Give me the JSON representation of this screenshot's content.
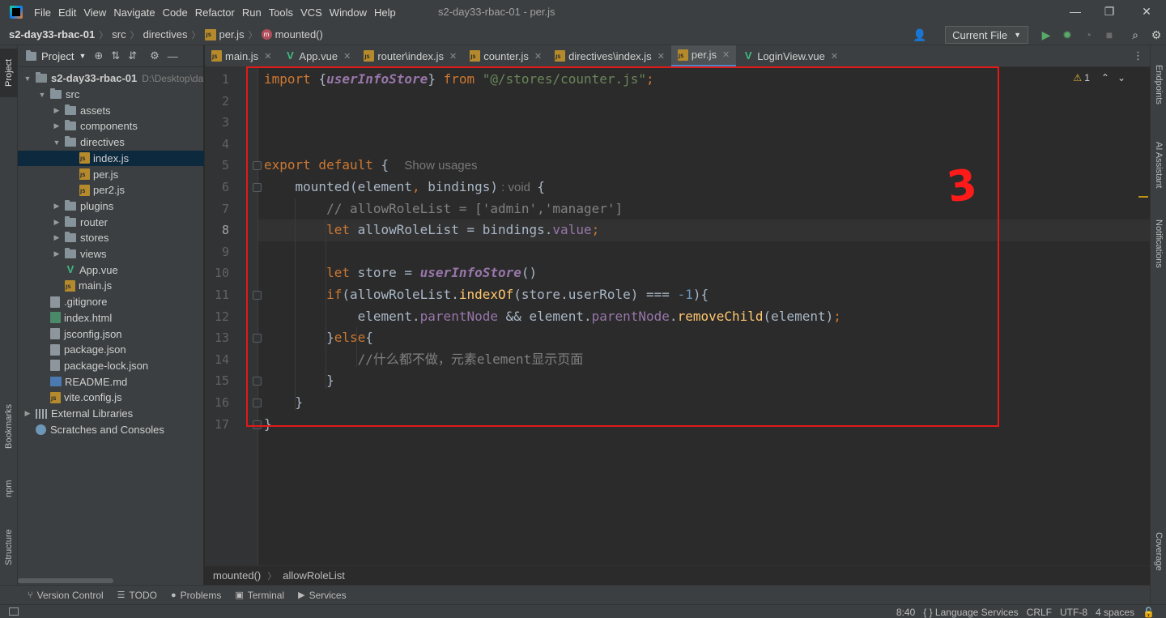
{
  "window": {
    "title": "s2-day33-rbac-01 - per.js",
    "minimize": "—",
    "restore": "❐",
    "close": "✕"
  },
  "menu": [
    "File",
    "Edit",
    "View",
    "Navigate",
    "Code",
    "Refactor",
    "Run",
    "Tools",
    "VCS",
    "Window",
    "Help"
  ],
  "navbar": {
    "project": "s2-day33-rbac-01",
    "crumbs": [
      "src",
      "directives",
      "per.js",
      "mounted()"
    ],
    "run_config": "Current File",
    "run_config_arrow": "▼"
  },
  "left_tabs": {
    "project": "Project",
    "bookmarks": "Bookmarks",
    "npm": "npm",
    "structure": "Structure"
  },
  "right_tabs": {
    "endpoints": "Endpoints",
    "ai_assistant": "AI Assistant",
    "notifications": "Notifications",
    "coverage": "Coverage"
  },
  "project_panel": {
    "title": "Project",
    "title_arrow": "▼",
    "root_path": "D:\\Desktop\\da",
    "tree": [
      {
        "label": "s2-day33-rbac-01",
        "kind": "root",
        "indent": 0,
        "arrow": "open"
      },
      {
        "label": "src",
        "kind": "folder",
        "indent": 1,
        "arrow": "open"
      },
      {
        "label": "assets",
        "kind": "folder",
        "indent": 2,
        "arrow": "closed"
      },
      {
        "label": "components",
        "kind": "folder",
        "indent": 2,
        "arrow": "closed"
      },
      {
        "label": "directives",
        "kind": "folder",
        "indent": 2,
        "arrow": "open"
      },
      {
        "label": "index.js",
        "kind": "js",
        "indent": 3,
        "arrow": "none",
        "selected": true
      },
      {
        "label": "per.js",
        "kind": "js",
        "indent": 3,
        "arrow": "none"
      },
      {
        "label": "per2.js",
        "kind": "js",
        "indent": 3,
        "arrow": "none"
      },
      {
        "label": "plugins",
        "kind": "folder",
        "indent": 2,
        "arrow": "closed"
      },
      {
        "label": "router",
        "kind": "folder",
        "indent": 2,
        "arrow": "closed"
      },
      {
        "label": "stores",
        "kind": "folder",
        "indent": 2,
        "arrow": "closed"
      },
      {
        "label": "views",
        "kind": "folder",
        "indent": 2,
        "arrow": "closed"
      },
      {
        "label": "App.vue",
        "kind": "vue",
        "indent": 2,
        "arrow": "none"
      },
      {
        "label": "main.js",
        "kind": "js",
        "indent": 2,
        "arrow": "none"
      },
      {
        "label": ".gitignore",
        "kind": "file",
        "indent": 1,
        "arrow": "none"
      },
      {
        "label": "index.html",
        "kind": "html",
        "indent": 1,
        "arrow": "none"
      },
      {
        "label": "jsconfig.json",
        "kind": "file",
        "indent": 1,
        "arrow": "none"
      },
      {
        "label": "package.json",
        "kind": "file",
        "indent": 1,
        "arrow": "none"
      },
      {
        "label": "package-lock.json",
        "kind": "file",
        "indent": 1,
        "arrow": "none"
      },
      {
        "label": "README.md",
        "kind": "md",
        "indent": 1,
        "arrow": "none"
      },
      {
        "label": "vite.config.js",
        "kind": "js",
        "indent": 1,
        "arrow": "none"
      },
      {
        "label": "External Libraries",
        "kind": "lib",
        "indent": 0,
        "arrow": "closed"
      },
      {
        "label": "Scratches and Consoles",
        "kind": "scratch",
        "indent": 0,
        "arrow": "none"
      }
    ]
  },
  "tabs": [
    {
      "label": "main.js",
      "kind": "js",
      "active": false
    },
    {
      "label": "App.vue",
      "kind": "vue",
      "active": false
    },
    {
      "label": "router\\index.js",
      "kind": "js",
      "active": false
    },
    {
      "label": "counter.js",
      "kind": "js",
      "active": false
    },
    {
      "label": "directives\\index.js",
      "kind": "js",
      "active": false
    },
    {
      "label": "per.js",
      "kind": "js",
      "active": true
    },
    {
      "label": "LoginView.vue",
      "kind": "vue",
      "active": false
    }
  ],
  "tab_close": "✕",
  "tabs_more": "⋮",
  "editor": {
    "warnings_count": "1",
    "current_line": 8,
    "line_numbers": [
      "1",
      "2",
      "3",
      "4",
      "5",
      "6",
      "7",
      "8",
      "9",
      "10",
      "11",
      "12",
      "13",
      "14",
      "15",
      "16",
      "17"
    ],
    "annotation": "3",
    "lines": [
      [
        [
          "kw",
          "import "
        ],
        [
          "",
          "{"
        ],
        [
          "fn-it",
          "userInfoStore"
        ],
        [
          "",
          "} "
        ],
        [
          "kw",
          "from "
        ],
        [
          "str",
          "\"@/stores/counter.js\""
        ],
        [
          "kw",
          ";"
        ]
      ],
      [],
      [],
      [],
      [
        [
          "kw",
          "export default "
        ],
        [
          "",
          "{  "
        ],
        [
          "hint",
          "Show usages"
        ]
      ],
      [
        [
          "",
          "    "
        ],
        [
          "prop-m",
          "mounted"
        ],
        [
          "",
          "(element"
        ],
        [
          "kw",
          ", "
        ],
        [
          "",
          "bindings)"
        ],
        [
          "hint",
          " : void  "
        ],
        [
          "",
          "{"
        ]
      ],
      [
        [
          "",
          "        "
        ],
        [
          "cmt",
          "// allowRoleList = ['admin','manager']"
        ]
      ],
      [
        [
          "",
          "        "
        ],
        [
          "kw",
          "let "
        ],
        [
          "",
          "allowRoleList = bindings."
        ],
        [
          "prop",
          "value"
        ],
        [
          "kw",
          ";"
        ]
      ],
      [],
      [
        [
          "",
          "        "
        ],
        [
          "kw",
          "let "
        ],
        [
          "",
          "store = "
        ],
        [
          "fn-it",
          "userInfoStore"
        ],
        [
          "",
          "()"
        ]
      ],
      [
        [
          "",
          "        "
        ],
        [
          "kw",
          "if"
        ],
        [
          "",
          "(allowRoleList."
        ],
        [
          "meth",
          "indexOf"
        ],
        [
          "",
          "(store.userRole) === "
        ],
        [
          "num",
          "-1"
        ],
        [
          "",
          "){"
        ]
      ],
      [
        [
          "",
          "            "
        ],
        [
          "",
          "element."
        ],
        [
          "prop",
          "parentNode "
        ],
        [
          "",
          "&& element."
        ],
        [
          "prop",
          "parentNode"
        ],
        [
          "",
          "."
        ],
        [
          "meth",
          "removeChild"
        ],
        [
          "",
          "(element)"
        ],
        [
          "kw",
          ";"
        ]
      ],
      [
        [
          "",
          "        "
        ],
        [
          "",
          "}"
        ],
        [
          "kw",
          "else"
        ],
        [
          "",
          "{"
        ]
      ],
      [
        [
          "",
          "            "
        ],
        [
          "cmt",
          "//什么都不做，元素element显示页面"
        ]
      ],
      [
        [
          "",
          "        "
        ],
        [
          "",
          "}"
        ]
      ],
      [
        [
          "",
          "    "
        ],
        [
          "",
          "}"
        ]
      ],
      [
        [
          "",
          "}"
        ]
      ]
    ]
  },
  "editor_crumbs": [
    "mounted()",
    "allowRoleList"
  ],
  "bottom_tools": [
    "Version Control",
    "TODO",
    "Problems",
    "Terminal",
    "Services"
  ],
  "status": {
    "position": "8:40",
    "language_services": "{ } Language Services",
    "line_sep": "CRLF",
    "encoding": "UTF-8",
    "indent": "4 spaces"
  }
}
